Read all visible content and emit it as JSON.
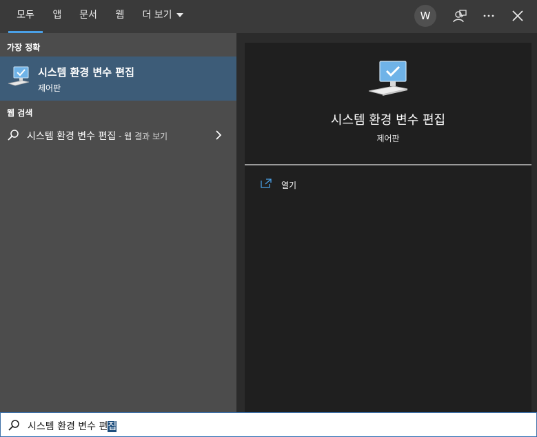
{
  "tabs": [
    {
      "label": "모두"
    },
    {
      "label": "앱"
    },
    {
      "label": "문서"
    },
    {
      "label": "웹"
    },
    {
      "label": "더 보기"
    }
  ],
  "topbar": {
    "avatar_letter": "W",
    "icons": [
      "feedback-icon",
      "more-icon",
      "close-icon"
    ]
  },
  "left": {
    "best_match_header": "가장 정확",
    "best_match": {
      "title": "시스템 환경 변수 편집",
      "subtitle": "제어판"
    },
    "web_header": "웹 검색",
    "web_item": {
      "text": "시스템 환경 변수 편집",
      "suffix": " - 웹 결과 보기"
    }
  },
  "detail": {
    "title": "시스템 환경 변수 편집",
    "subtitle": "제어판",
    "actions": [
      {
        "label": "열기"
      }
    ]
  },
  "search": {
    "value_prefix": "시스템 환경 변수 편",
    "value_selected": "집"
  },
  "colors": {
    "accent": "#4aa0e6",
    "selected_row": "#3d5c78",
    "left_bg": "#4c4c4c",
    "detail_bg": "#1f1f1f"
  }
}
